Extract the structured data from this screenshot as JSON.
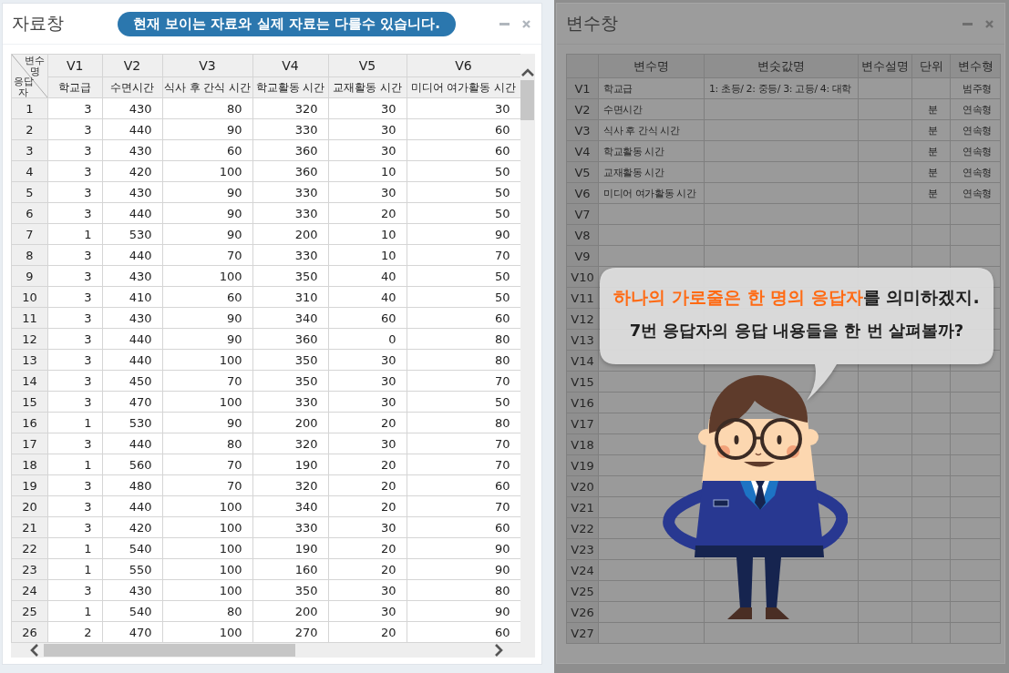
{
  "data_window": {
    "title": "자료창",
    "notice": "현재 보이는 자료와 실제 자료는 다를수 있습니다.",
    "corner": {
      "column_label": "변수명",
      "row_label": "응답자"
    },
    "columns": [
      {
        "name": "V1",
        "label": "학교급"
      },
      {
        "name": "V2",
        "label": "수면시간"
      },
      {
        "name": "V3",
        "label": "식사 후 간식 시간"
      },
      {
        "name": "V4",
        "label": "학교활동 시간"
      },
      {
        "name": "V5",
        "label": "교재활동 시간"
      },
      {
        "name": "V6",
        "label": "미디어 여가활동 시간"
      }
    ],
    "rows": [
      {
        "index": "1",
        "values": [
          "3",
          "430",
          "80",
          "320",
          "30",
          "30"
        ]
      },
      {
        "index": "2",
        "values": [
          "3",
          "440",
          "90",
          "330",
          "30",
          "60"
        ]
      },
      {
        "index": "3",
        "values": [
          "3",
          "430",
          "60",
          "360",
          "30",
          "60"
        ]
      },
      {
        "index": "4",
        "values": [
          "3",
          "420",
          "100",
          "360",
          "10",
          "50"
        ]
      },
      {
        "index": "5",
        "values": [
          "3",
          "430",
          "90",
          "330",
          "30",
          "50"
        ]
      },
      {
        "index": "6",
        "values": [
          "3",
          "440",
          "90",
          "330",
          "20",
          "50"
        ]
      },
      {
        "index": "7",
        "values": [
          "1",
          "530",
          "90",
          "200",
          "10",
          "90"
        ]
      },
      {
        "index": "8",
        "values": [
          "3",
          "440",
          "70",
          "330",
          "10",
          "70"
        ]
      },
      {
        "index": "9",
        "values": [
          "3",
          "430",
          "100",
          "350",
          "40",
          "50"
        ]
      },
      {
        "index": "10",
        "values": [
          "3",
          "410",
          "60",
          "310",
          "40",
          "50"
        ]
      },
      {
        "index": "11",
        "values": [
          "3",
          "430",
          "90",
          "340",
          "60",
          "60"
        ]
      },
      {
        "index": "12",
        "values": [
          "3",
          "440",
          "90",
          "360",
          "0",
          "80"
        ]
      },
      {
        "index": "13",
        "values": [
          "3",
          "440",
          "100",
          "350",
          "30",
          "80"
        ]
      },
      {
        "index": "14",
        "values": [
          "3",
          "450",
          "70",
          "350",
          "30",
          "70"
        ]
      },
      {
        "index": "15",
        "values": [
          "3",
          "470",
          "100",
          "330",
          "30",
          "50"
        ]
      },
      {
        "index": "16",
        "values": [
          "1",
          "530",
          "90",
          "200",
          "20",
          "80"
        ]
      },
      {
        "index": "17",
        "values": [
          "3",
          "440",
          "80",
          "320",
          "30",
          "70"
        ]
      },
      {
        "index": "18",
        "values": [
          "1",
          "560",
          "70",
          "190",
          "20",
          "70"
        ]
      },
      {
        "index": "19",
        "values": [
          "3",
          "480",
          "70",
          "320",
          "20",
          "60"
        ]
      },
      {
        "index": "20",
        "values": [
          "3",
          "440",
          "100",
          "340",
          "20",
          "70"
        ]
      },
      {
        "index": "21",
        "values": [
          "3",
          "420",
          "100",
          "330",
          "30",
          "60"
        ]
      },
      {
        "index": "22",
        "values": [
          "1",
          "540",
          "100",
          "190",
          "20",
          "90"
        ]
      },
      {
        "index": "23",
        "values": [
          "1",
          "550",
          "100",
          "160",
          "20",
          "90"
        ]
      },
      {
        "index": "24",
        "values": [
          "3",
          "430",
          "100",
          "350",
          "30",
          "80"
        ]
      },
      {
        "index": "25",
        "values": [
          "1",
          "540",
          "80",
          "200",
          "30",
          "90"
        ]
      },
      {
        "index": "26",
        "values": [
          "2",
          "470",
          "100",
          "270",
          "20",
          "60"
        ]
      }
    ]
  },
  "variable_window": {
    "title": "변수창",
    "dimmed": true,
    "columns": [
      "변수명",
      "변숫값명",
      "변수설명",
      "단위",
      "변수형"
    ],
    "rows": [
      {
        "label": "V1",
        "name": "학교급",
        "value_labels": "1: 초등/ 2: 중등/ 3: 고등/ 4: 대학",
        "type": "범주형"
      },
      {
        "label": "V2",
        "name": "수면시간",
        "unit": "분",
        "type": "연속형"
      },
      {
        "label": "V3",
        "name": "식사 후 간식 시간",
        "unit": "분",
        "type": "연속형"
      },
      {
        "label": "V4",
        "name": "학교활동 시간",
        "unit": "분",
        "type": "연속형"
      },
      {
        "label": "V5",
        "name": "교재활동 시간",
        "unit": "분",
        "type": "연속형"
      },
      {
        "label": "V6",
        "name": "미디어 여가활동 시간",
        "unit": "분",
        "type": "연속형"
      },
      {
        "label": "V7"
      },
      {
        "label": "V8"
      },
      {
        "label": "V9"
      },
      {
        "label": "V10"
      },
      {
        "label": "V11"
      },
      {
        "label": "V12"
      },
      {
        "label": "V13"
      },
      {
        "label": "V14"
      },
      {
        "label": "V15"
      },
      {
        "label": "V16"
      },
      {
        "label": "V17"
      },
      {
        "label": "V18"
      },
      {
        "label": "V19"
      },
      {
        "label": "V20"
      },
      {
        "label": "V21"
      },
      {
        "label": "V22"
      },
      {
        "label": "V23"
      },
      {
        "label": "V24"
      },
      {
        "label": "V25"
      },
      {
        "label": "V26"
      },
      {
        "label": "V27"
      }
    ]
  },
  "speech_bubble": {
    "lines": [
      {
        "highlight": "하나의 가로줄은 한 명의 응답자",
        "text": "를 의미하겠지."
      },
      {
        "text": "7번 응답자의 응답 내용들을 한 번 살펴볼까?"
      }
    ]
  }
}
